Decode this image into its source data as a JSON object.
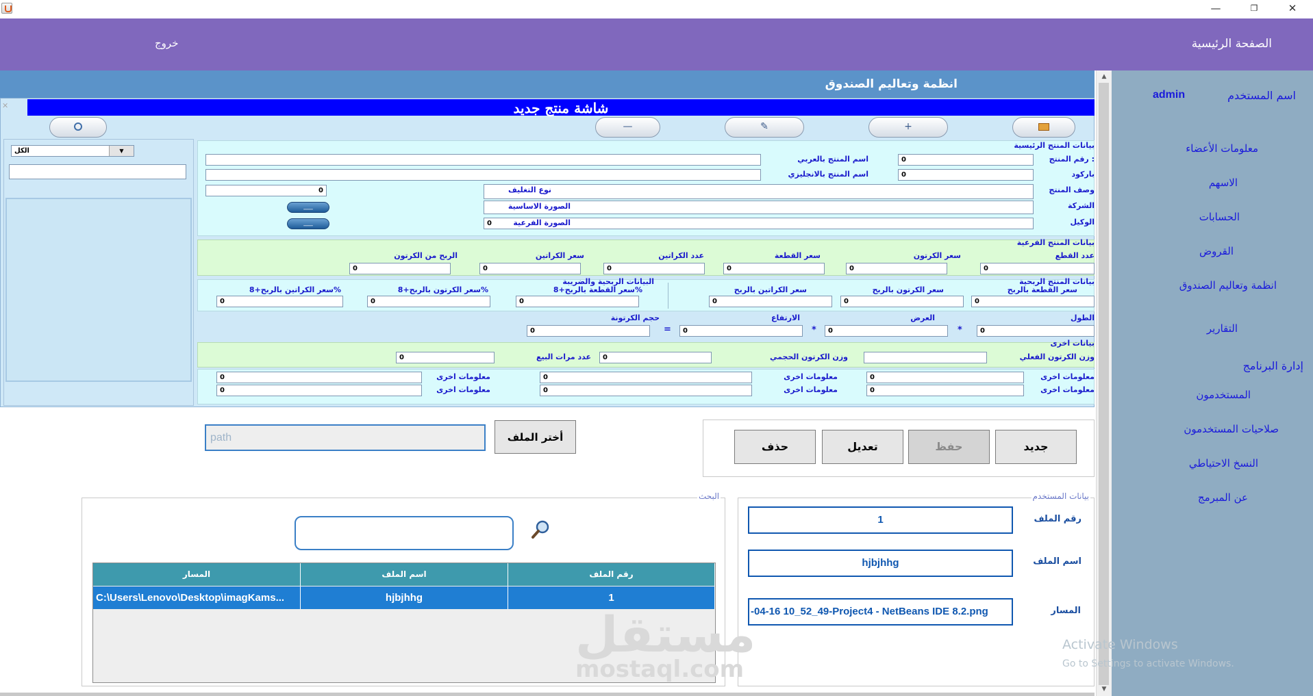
{
  "window": {
    "minimize": "—",
    "maximize": "❐",
    "close": "✕"
  },
  "header": {
    "home": "الصفحة الرئيسية",
    "exit": "خروج"
  },
  "sidebar": {
    "username_label": "اسم المستخدم",
    "username": "admin",
    "items": [
      "معلومات الأعضاء",
      "الاسهم",
      "الحسابات",
      "القروض",
      "انظمة وتعاليم الصندوق",
      "التقارير"
    ],
    "admin_section": "إدارة البرنامج",
    "admin_items": [
      "المستخدمون",
      "صلاحيات المستخدمون",
      "النسخ الاحتياطي",
      "عن المبرمج"
    ]
  },
  "fund_title": "انظمة وتعاليم الصندوق",
  "internal_frame": {
    "title": "شاشة منتج جديد",
    "toolbar": {
      "add": "+",
      "edit": "✎",
      "remove": "—"
    },
    "left_panel": {
      "filter_value": "الكل"
    },
    "main_section": "بيانات المنتج الرئيسية",
    "labels": {
      "product_no": "رقم المنتج :",
      "barcode": "باركود",
      "product_desc": "وصف المنتج",
      "company": "الشركة",
      "agent": "الوكيل",
      "name_ar": "اسم المنتج بالعربي",
      "name_en": "اسم المنتج بالانجليزي",
      "packing_type": "نوع التغليف",
      "main_image": "الصورة الاساسية",
      "sub_image": "الصورة الفرعية",
      "sub_section": "بيانات المنتج الفرعية",
      "pieces_count": "عدد القطع",
      "carton_price": "سعر الكرتون",
      "piece_price": "سعر القطعة",
      "cartons_count": "عدد الكراتين",
      "cartons_price": "سعر الكراتين",
      "carton_profit": "الربح من الكرتون",
      "profit_section": "بيانات المنتج الربحية",
      "profit_tax_section": "البيانات الربحية والضريبة",
      "piece_price_profit": "سعر القطعة بالربح",
      "carton_price_profit": "سعر الكرتون بالربح",
      "cartons_price_profit": "سعر الكراتين بالربح",
      "piece_price_tax": "سعر القطعة بالربح+8%",
      "carton_price_tax": "سعر الكرتون بالربح+8%",
      "cartons_price_tax": "سعر الكراتين بالربح+8%",
      "length": "الطول",
      "width": "العرض",
      "height": "الارتفاع",
      "carton_volume": "حجم الكرتونة",
      "other_section": "بيانات اخرى",
      "carton_actual_weight": "وزن الكرتون الفعلي",
      "carton_volume_weight": "وزن الكرتون الحجمي",
      "sales_count": "عدد مرات البيع",
      "other_info": "معلومات اخرى"
    },
    "zero": "0",
    "button_dots": "___",
    "op_mul": "*",
    "op_eq": "="
  },
  "file_section": {
    "choose_button": "أختر الملف",
    "path_placeholder": "path"
  },
  "crud": {
    "new": "جديد",
    "save": "حفظ",
    "edit": "تعديل",
    "delete": "حذف"
  },
  "user_data": {
    "title": "بيانات المستخدم",
    "file_no_label": "رقم الملف",
    "file_no": "1",
    "file_name_label": "اسم الملف",
    "file_name": "hjbjhhg",
    "path_label": "المسار",
    "path": "-04-16 10_52_49-Project4 - NetBeans IDE 8.2.png"
  },
  "search": {
    "title": "البحث",
    "columns": [
      "رقم الملف",
      "اسم الملف",
      "المسار"
    ],
    "rows": [
      {
        "file_no": "1",
        "file_name": "hjbjhhg",
        "path": "C:\\Users\\Lenovo\\Desktop\\imagKams..."
      }
    ]
  },
  "watermark": {
    "arabic": "مستقل",
    "latin": "mostaql.com"
  },
  "activate": {
    "line1": "Activate Windows",
    "line2": "Go to Settings to activate Windows."
  }
}
